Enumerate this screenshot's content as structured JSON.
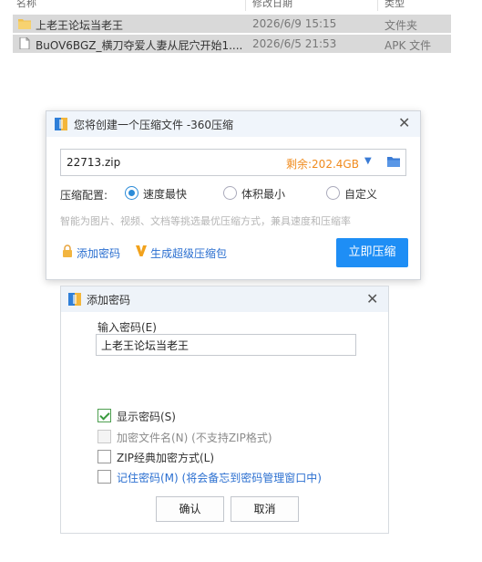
{
  "explorer": {
    "columns": [
      {
        "label": "名称"
      },
      {
        "label": "修改日期"
      },
      {
        "label": "类型"
      }
    ],
    "files": [
      {
        "name": "上老王论坛当老王",
        "date": "2026/6/9 15:15",
        "type": "文件夹",
        "icon": "folder-icon"
      },
      {
        "name": "BuOV6BGZ_横刀夺爱人妻从屁穴开始1....",
        "date": "2026/6/5 21:53",
        "type": "APK 文件",
        "icon": "file-icon"
      }
    ]
  },
  "compress_dialog": {
    "title": "您将创建一个压缩文件 -360压缩",
    "path_value": "22713.zip",
    "free_space": "剩余:202.4GB",
    "config_label": "压缩配置:",
    "options": [
      {
        "label": "速度最快",
        "selected": true
      },
      {
        "label": "体积最小",
        "selected": false
      },
      {
        "label": "自定义",
        "selected": false
      }
    ],
    "hint": "智能为图片、视频、文档等挑选最优压缩方式，兼具速度和压缩率",
    "add_password_link": "添加密码",
    "super_pack_link": "生成超级压缩包",
    "compress_button": "立即压缩"
  },
  "password_dialog": {
    "title": "添加密码",
    "input_label": "输入密码(E)",
    "password_value": "上老王论坛当老王",
    "checkboxes": [
      {
        "label": "显示密码(S)",
        "checked": true,
        "disabled": false
      },
      {
        "label": "加密文件名(N) (不支持ZIP格式)",
        "checked": false,
        "disabled": true
      },
      {
        "label": "ZIP经典加密方式(L)",
        "checked": false,
        "disabled": false
      },
      {
        "label": "记住密码(M) (将会备忘到密码管理窗口中)",
        "checked": false,
        "disabled": false
      }
    ],
    "ok_button": "确认",
    "cancel_button": "取消"
  },
  "colors": {
    "accent": "#1e8ef5",
    "link": "#2b6fd0",
    "free_space": "#f08a1c",
    "check_green": "#3b9a3f"
  }
}
